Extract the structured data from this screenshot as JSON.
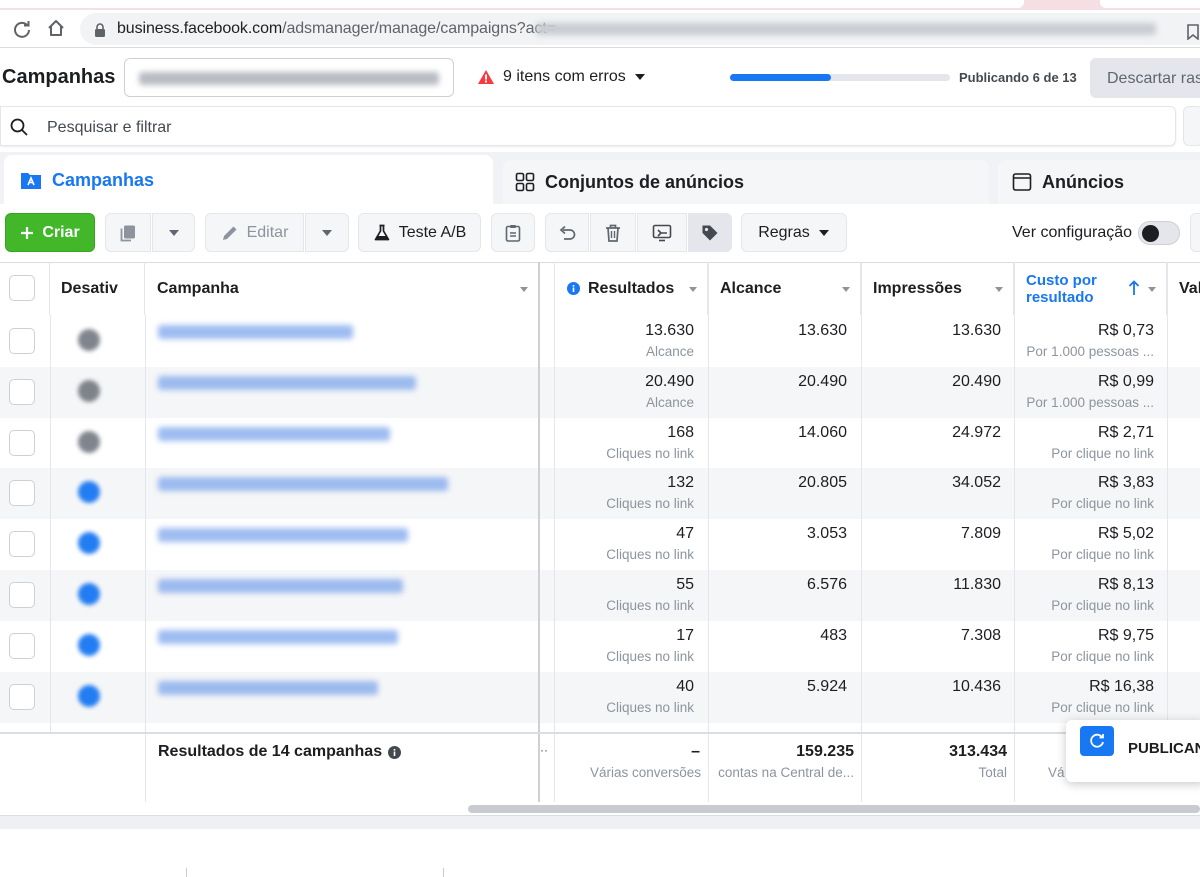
{
  "browser": {
    "url_domain": "business.facebook.com",
    "url_path": "/adsmanager/manage/campaigns?act="
  },
  "header": {
    "title": "Campanhas",
    "errors_label": "9 itens com erros",
    "publishing_status": "Publicando 6 de 13",
    "publishing_progress": 0.46,
    "discard_label": "Descartar ras"
  },
  "search": {
    "placeholder": "Pesquisar e filtrar"
  },
  "tabs": [
    {
      "label": "Campanhas",
      "active": true
    },
    {
      "label": "Conjuntos de anúncios",
      "active": false
    },
    {
      "label": "Anúncios",
      "active": false
    }
  ],
  "toolbar": {
    "create_label": "Criar",
    "edit_label": "Editar",
    "ab_test_label": "Teste A/B",
    "rules_label": "Regras",
    "view_settings_label": "Ver configuração"
  },
  "table": {
    "columns": {
      "off": "Desativ",
      "campaign": "Campanha",
      "results": "Resultados",
      "reach": "Alcance",
      "impressions": "Impressões",
      "cost_per_result": "Custo por resultado",
      "value": "Val"
    },
    "rows": [
      {
        "results": "13.630",
        "results_type": "Alcance",
        "reach": "13.630",
        "impressions": "13.630",
        "cost": "R$ 0,73",
        "cost_type": "Por 1.000 pessoas ...",
        "status_color": "#606770"
      },
      {
        "results": "20.490",
        "results_type": "Alcance",
        "reach": "20.490",
        "impressions": "20.490",
        "cost": "R$ 0,99",
        "cost_type": "Por 1.000 pessoas ...",
        "status_color": "#606770"
      },
      {
        "results": "168",
        "results_type": "Cliques no link",
        "reach": "14.060",
        "impressions": "24.972",
        "cost": "R$ 2,71",
        "cost_type": "Por clique no link",
        "status_color": "#606770"
      },
      {
        "results": "132",
        "results_type": "Cliques no link",
        "reach": "20.805",
        "impressions": "34.052",
        "cost": "R$ 3,83",
        "cost_type": "Por clique no link",
        "status_color": "#1877f2"
      },
      {
        "results": "47",
        "results_type": "Cliques no link",
        "reach": "3.053",
        "impressions": "7.809",
        "cost": "R$ 5,02",
        "cost_type": "Por clique no link",
        "status_color": "#1877f2"
      },
      {
        "results": "55",
        "results_type": "Cliques no link",
        "reach": "6.576",
        "impressions": "11.830",
        "cost": "R$ 8,13",
        "cost_type": "Por clique no link",
        "status_color": "#1877f2"
      },
      {
        "results": "17",
        "results_type": "Cliques no link",
        "reach": "483",
        "impressions": "7.308",
        "cost": "R$ 9,75",
        "cost_type": "Por clique no link",
        "status_color": "#1877f2"
      },
      {
        "results": "40",
        "results_type": "Cliques no link",
        "reach": "5.924",
        "impressions": "10.436",
        "cost": "R$ 16,38",
        "cost_type": "Por clique no link",
        "status_color": "#1877f2"
      }
    ],
    "footer": {
      "label": "Resultados de 14 campanhas",
      "results": "–",
      "results_sub": "Várias conversões",
      "reach": "159.235",
      "reach_sub": "contas na Central de...",
      "impressions": "313.434",
      "impressions_sub": "Total",
      "extra_sub": "Vá"
    }
  },
  "publishing_popup": {
    "label": "PUBLICAN"
  },
  "colors": {
    "accent": "#1877f2",
    "create": "#42b72a",
    "error": "#fa383e"
  }
}
